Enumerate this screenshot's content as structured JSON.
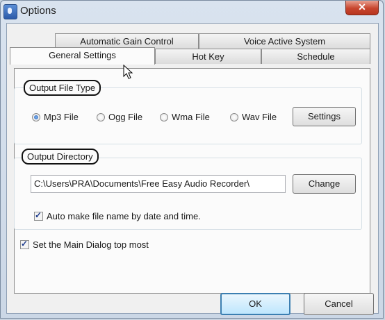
{
  "window": {
    "title": "Options",
    "close_glyph": "✕"
  },
  "tabs": {
    "back": [
      "Automatic Gain Control",
      "Voice Active System"
    ],
    "front": [
      "General Settings",
      "Hot Key",
      "Schedule"
    ],
    "active": "General Settings"
  },
  "output_file_type": {
    "title": "Output File Type",
    "options": [
      "Mp3 File",
      "Ogg File",
      "Wma File",
      "Wav File"
    ],
    "selected": "Mp3 File",
    "settings_button": "Settings"
  },
  "output_directory": {
    "title": "Output Directory",
    "path": "C:\\Users\\PRA\\Documents\\Free Easy Audio Recorder\\",
    "change_button": "Change",
    "auto_name_label": "Auto make file name by date and time.",
    "auto_name_checked": true
  },
  "topmost": {
    "label": "Set the Main Dialog top most",
    "checked": true
  },
  "footer": {
    "ok": "OK",
    "cancel": "Cancel"
  },
  "icons": [
    "app-icon",
    "close-icon",
    "mouse-cursor-icon"
  ]
}
